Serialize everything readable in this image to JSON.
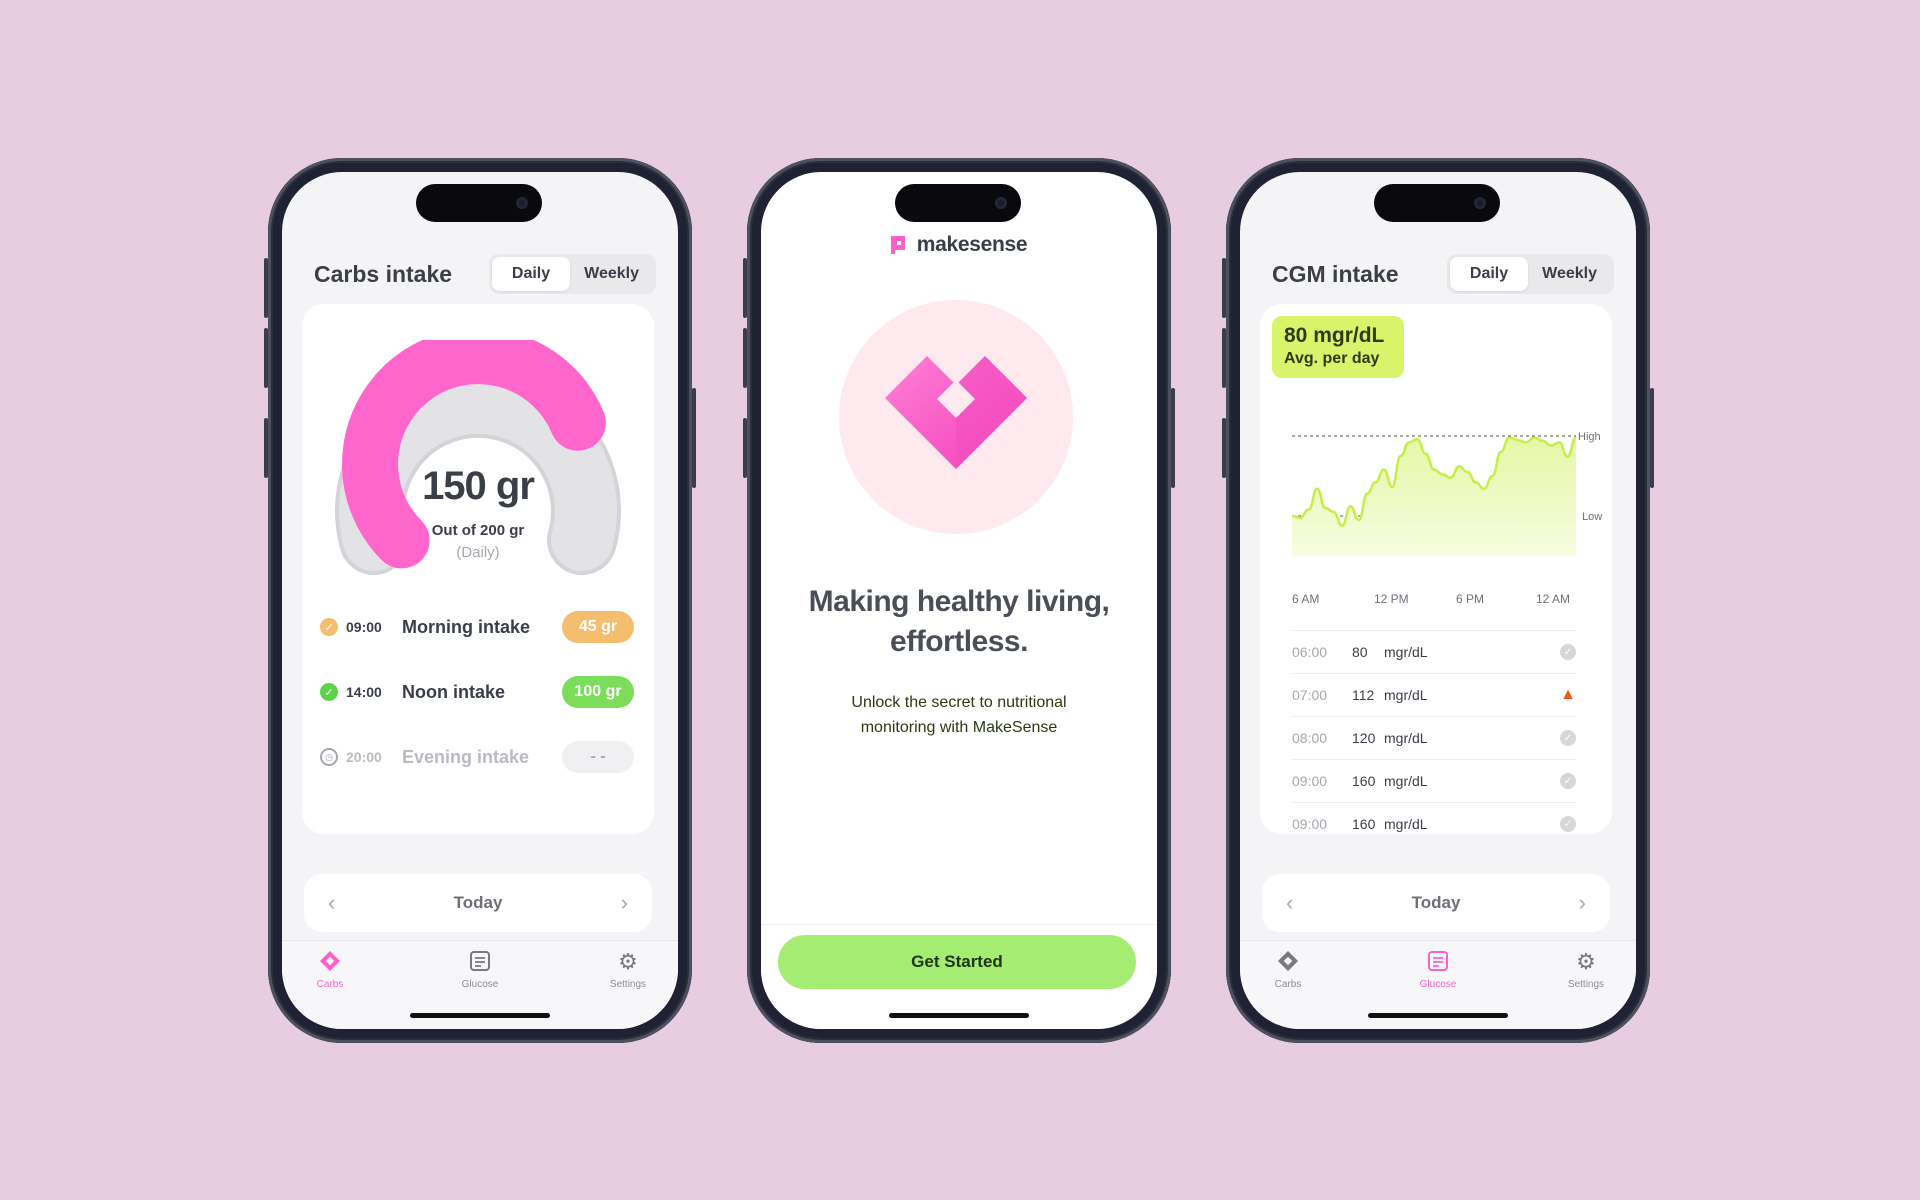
{
  "colors": {
    "background": "#E8CCE0",
    "accent_pink": "#FF5FCB",
    "accent_green": "#A5EC73",
    "accent_lime": "#D9F46A"
  },
  "screens": {
    "carbs": {
      "title": "Carbs intake",
      "segment": [
        "Daily",
        "Weekly"
      ],
      "selected_segment": "Daily",
      "gauge": {
        "value": "150 gr",
        "subtitle": "Out of 200 gr",
        "period": "(Daily)",
        "progress": 0.75
      },
      "intakes": [
        {
          "time": "09:00",
          "name": "Morning intake",
          "amount": "45 gr",
          "status": "check-icon"
        },
        {
          "time": "14:00",
          "name": "Noon intake",
          "amount": "100 gr",
          "status": "check-icon"
        },
        {
          "time": "20:00",
          "name": "Evening intake",
          "amount": "- -",
          "status": "clock-icon"
        }
      ],
      "nav": {
        "label": "Today"
      },
      "tabs": [
        "Carbs",
        "Glucose",
        "Settings"
      ],
      "active_tab": "Carbs"
    },
    "onboarding": {
      "brand": "makesense",
      "headline_line1": "Making healthy living,",
      "headline_line2": "effortless.",
      "sub_line1": "Unlock the secret to nutritional",
      "sub_line2": "monitoring with MakeSense",
      "cta": "Get Started"
    },
    "glucose": {
      "title": "CGM intake",
      "segment": [
        "Daily",
        "Weekly"
      ],
      "selected_segment": "Daily",
      "avg_value": "80 mgr/dL",
      "avg_label": "Avg. per day",
      "chart_data": {
        "type": "area",
        "x_ticks": [
          "6 AM",
          "12 PM",
          "6 PM",
          "12 AM"
        ],
        "reference_lines": [
          {
            "label": "High",
            "value": 1.0
          },
          {
            "label": "Low",
            "value": 0.0
          }
        ],
        "series": [
          {
            "values": [
              0.0,
              -0.02,
              0.08,
              0.34,
              0.1,
              0.05,
              -0.12,
              0.12,
              -0.05,
              0.28,
              0.42,
              0.58,
              0.36,
              0.75,
              0.92,
              0.96,
              0.78,
              0.58,
              0.52,
              0.48,
              0.62,
              0.55,
              0.42,
              0.34,
              0.5,
              0.8,
              0.98,
              0.95,
              0.92,
              0.98,
              0.94,
              0.88,
              0.92,
              0.74,
              0.98
            ]
          }
        ]
      },
      "readings": [
        {
          "time": "06:00",
          "value": "80",
          "unit": "mgr/dL",
          "status": "check"
        },
        {
          "time": "07:00",
          "value": "112",
          "unit": "mgr/dL",
          "status": "warning"
        },
        {
          "time": "08:00",
          "value": "120",
          "unit": "mgr/dL",
          "status": "check"
        },
        {
          "time": "09:00",
          "value": "160",
          "unit": "mgr/dL",
          "status": "check"
        },
        {
          "time": "09:00",
          "value": "160",
          "unit": "mgr/dL",
          "status": "check"
        }
      ],
      "nav": {
        "label": "Today"
      },
      "tabs": [
        "Carbs",
        "Glucose",
        "Settings"
      ],
      "active_tab": "Glucose"
    }
  }
}
